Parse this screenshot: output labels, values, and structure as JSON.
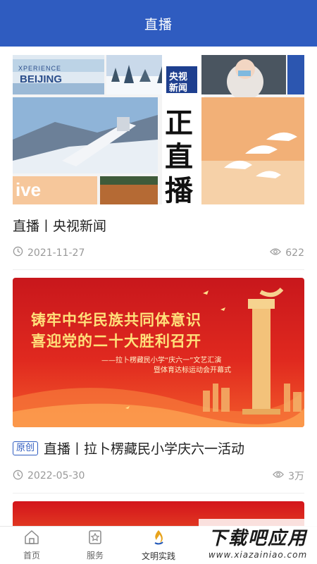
{
  "header": {
    "title": "直播"
  },
  "cards": [
    {
      "title": "直播丨央视新闻",
      "date": "2021-11-27",
      "views": "622",
      "thumb": {
        "logo_top": "央视",
        "logo_bottom": "新闻",
        "big_text": [
          "正",
          "直",
          "播"
        ],
        "live_text": "ive",
        "sign_text_1": "XPERIENCE",
        "sign_text_2": "BEIJING"
      }
    },
    {
      "badge": "原创",
      "title": "直播丨拉卜楞藏民小学庆六一活动",
      "date": "2022-05-30",
      "views": "3万",
      "banner": {
        "line1": "铸牢中华民族共同体意识",
        "line2": "喜迎党的二十大胜利召开",
        "sub1": "——拉卜楞藏民小学“庆六一”文艺汇演",
        "sub2": "暨体育达标运动会开幕式"
      }
    }
  ],
  "tabbar": {
    "items": [
      {
        "label": "首页",
        "icon": "home-icon"
      },
      {
        "label": "服务",
        "icon": "star-badge-icon"
      },
      {
        "label": "文明实践",
        "icon": "flame-logo-icon"
      },
      {
        "label": "",
        "icon": ""
      },
      {
        "label": "",
        "icon": ""
      }
    ]
  },
  "watermark": {
    "big": "下载吧应用",
    "small": "www.xiazainiao.com"
  },
  "colors": {
    "brand": "#2f5cc0",
    "muted": "#999999",
    "banner_red": "#d3141b",
    "banner_gold": "#ffd86a"
  }
}
